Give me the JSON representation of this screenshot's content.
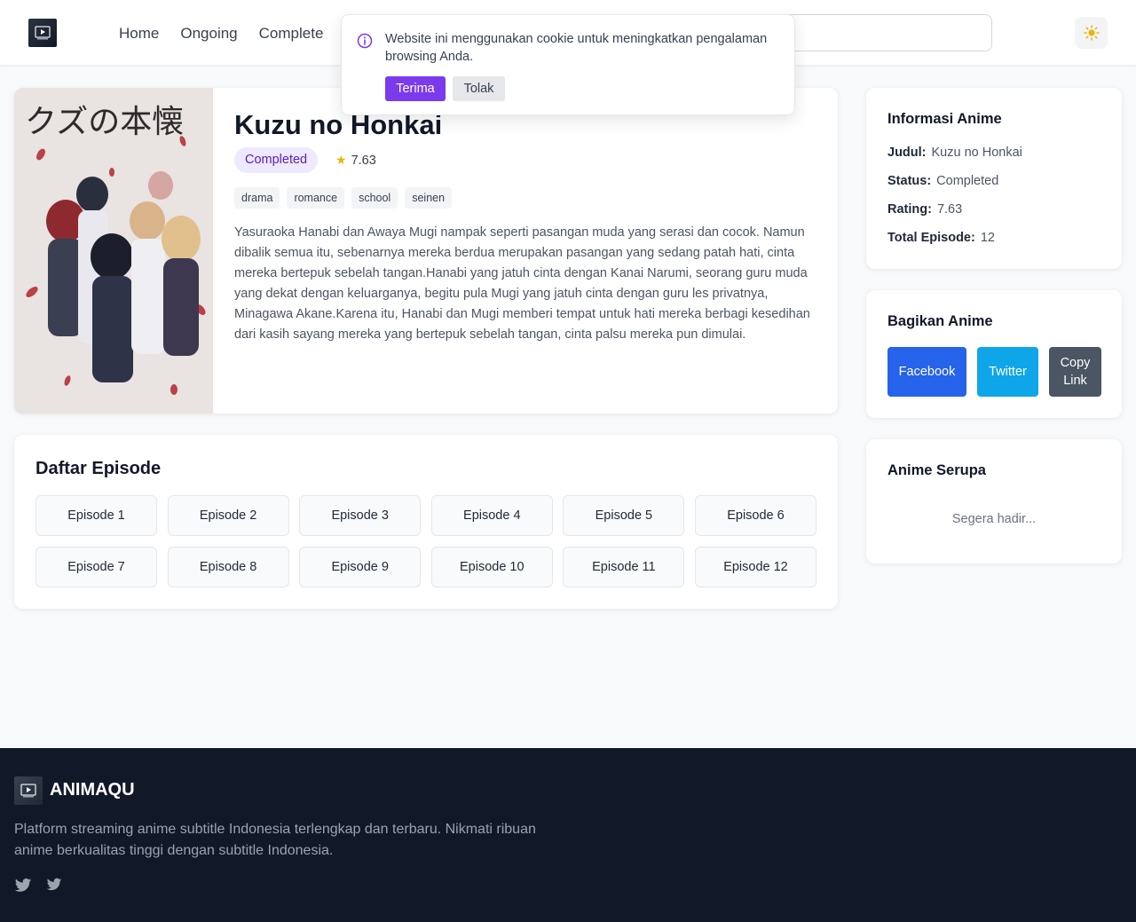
{
  "header": {
    "nav": [
      "Home",
      "Ongoing",
      "Complete"
    ],
    "theme_icon": "sun-icon"
  },
  "cookie": {
    "message": "Website ini menggunakan cookie untuk meningkatkan pengalaman browsing Anda.",
    "accept_label": "Terima",
    "reject_label": "Tolak",
    "icon": "info-icon"
  },
  "anime": {
    "title": "Kuzu no Honkai",
    "status": "Completed",
    "rating": "7.63",
    "genres": [
      "drama",
      "romance",
      "school",
      "seinen"
    ],
    "synopsis": "Yasuraoka Hanabi dan Awaya Mugi nampak seperti pasangan muda yang serasi dan cocok. Namun dibalik semua itu, sebenarnya mereka berdua merupakan pasangan yang sedang patah hati, cinta mereka bertepuk sebelah tangan.Hanabi yang jatuh cinta dengan Kanai Narumi, seorang guru muda yang dekat dengan keluarganya, begitu pula Mugi yang jatuh cinta dengan guru les privatnya, Minagawa Akane.Karena itu, Hanabi dan Mugi memberi tempat untuk hati mereka berbagi kesedihan dari kasih sayang mereka yang bertepuk sebelah tangan, cinta palsu mereka pun dimulai.",
    "poster_title": "クズの本懐"
  },
  "episodes": {
    "title": "Daftar Episode",
    "items": [
      "Episode 1",
      "Episode 2",
      "Episode 3",
      "Episode 4",
      "Episode 5",
      "Episode 6",
      "Episode 7",
      "Episode 8",
      "Episode 9",
      "Episode 10",
      "Episode 11",
      "Episode 12"
    ]
  },
  "info": {
    "title": "Informasi Anime",
    "judul_label": "Judul:",
    "judul": "Kuzu no Honkai",
    "status_label": "Status:",
    "status": "Completed",
    "rating_label": "Rating:",
    "rating": "7.63",
    "total_label": "Total Episode:",
    "total": "12"
  },
  "share": {
    "title": "Bagikan Anime",
    "facebook": "Facebook",
    "twitter": "Twitter",
    "copy": "Copy Link"
  },
  "similar": {
    "title": "Anime Serupa",
    "placeholder": "Segera hadir..."
  },
  "footer": {
    "brand": "ANIMAQU",
    "description": "Platform streaming anime subtitle Indonesia terlengkap dan terbaru. Nikmati ribuan anime berkualitas tinggi dengan subtitle Indonesia.",
    "social_icons": [
      "twitter-icon",
      "twitter-icon"
    ]
  },
  "colors": {
    "accent": "#7c3aed",
    "facebook": "#2563eb",
    "twitter": "#0ea5e9",
    "copy": "#4b5563",
    "footer_bg": "#111827"
  }
}
